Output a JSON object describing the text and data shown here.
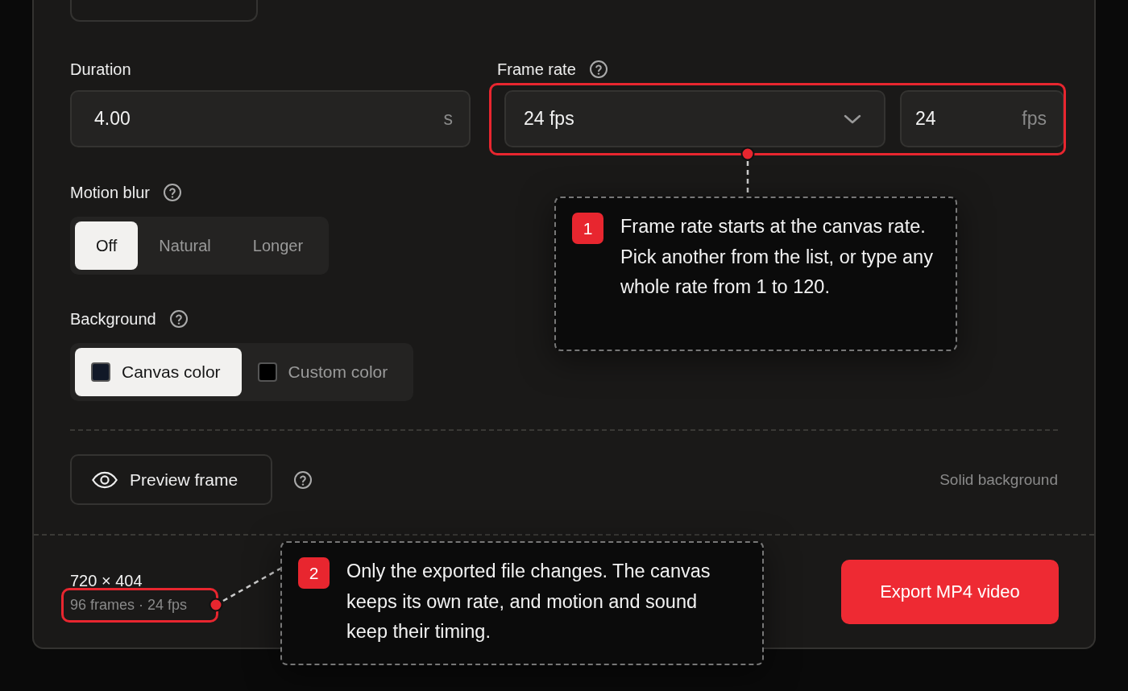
{
  "duration": {
    "label": "Duration",
    "value": "4.00",
    "unit": "s"
  },
  "frame_rate": {
    "label": "Frame rate",
    "select_value": "24 fps",
    "custom_value": "24",
    "custom_unit": "fps"
  },
  "motion_blur": {
    "label": "Motion blur",
    "options": [
      {
        "label": "Off",
        "selected": true
      },
      {
        "label": "Natural",
        "selected": false
      },
      {
        "label": "Longer",
        "selected": false
      }
    ]
  },
  "background": {
    "label": "Background",
    "options": [
      {
        "label": "Canvas color",
        "color": "#111827",
        "selected": true
      },
      {
        "label": "Custom color",
        "color": "#000000",
        "selected": false
      }
    ]
  },
  "preview_button": "Preview frame",
  "background_note": "Solid background",
  "footer": {
    "size": "720 × 404",
    "summary": "96 frames · 24 fps",
    "export_button": "Export MP4 video"
  },
  "callouts": [
    {
      "number": "1",
      "text": "Frame rate starts at the canvas rate. Pick another from the list, or type any whole rate from 1 to 120."
    },
    {
      "number": "2",
      "text": "Only the exported file changes. The canvas keeps its own rate, and motion and sound keep their timing."
    }
  ]
}
